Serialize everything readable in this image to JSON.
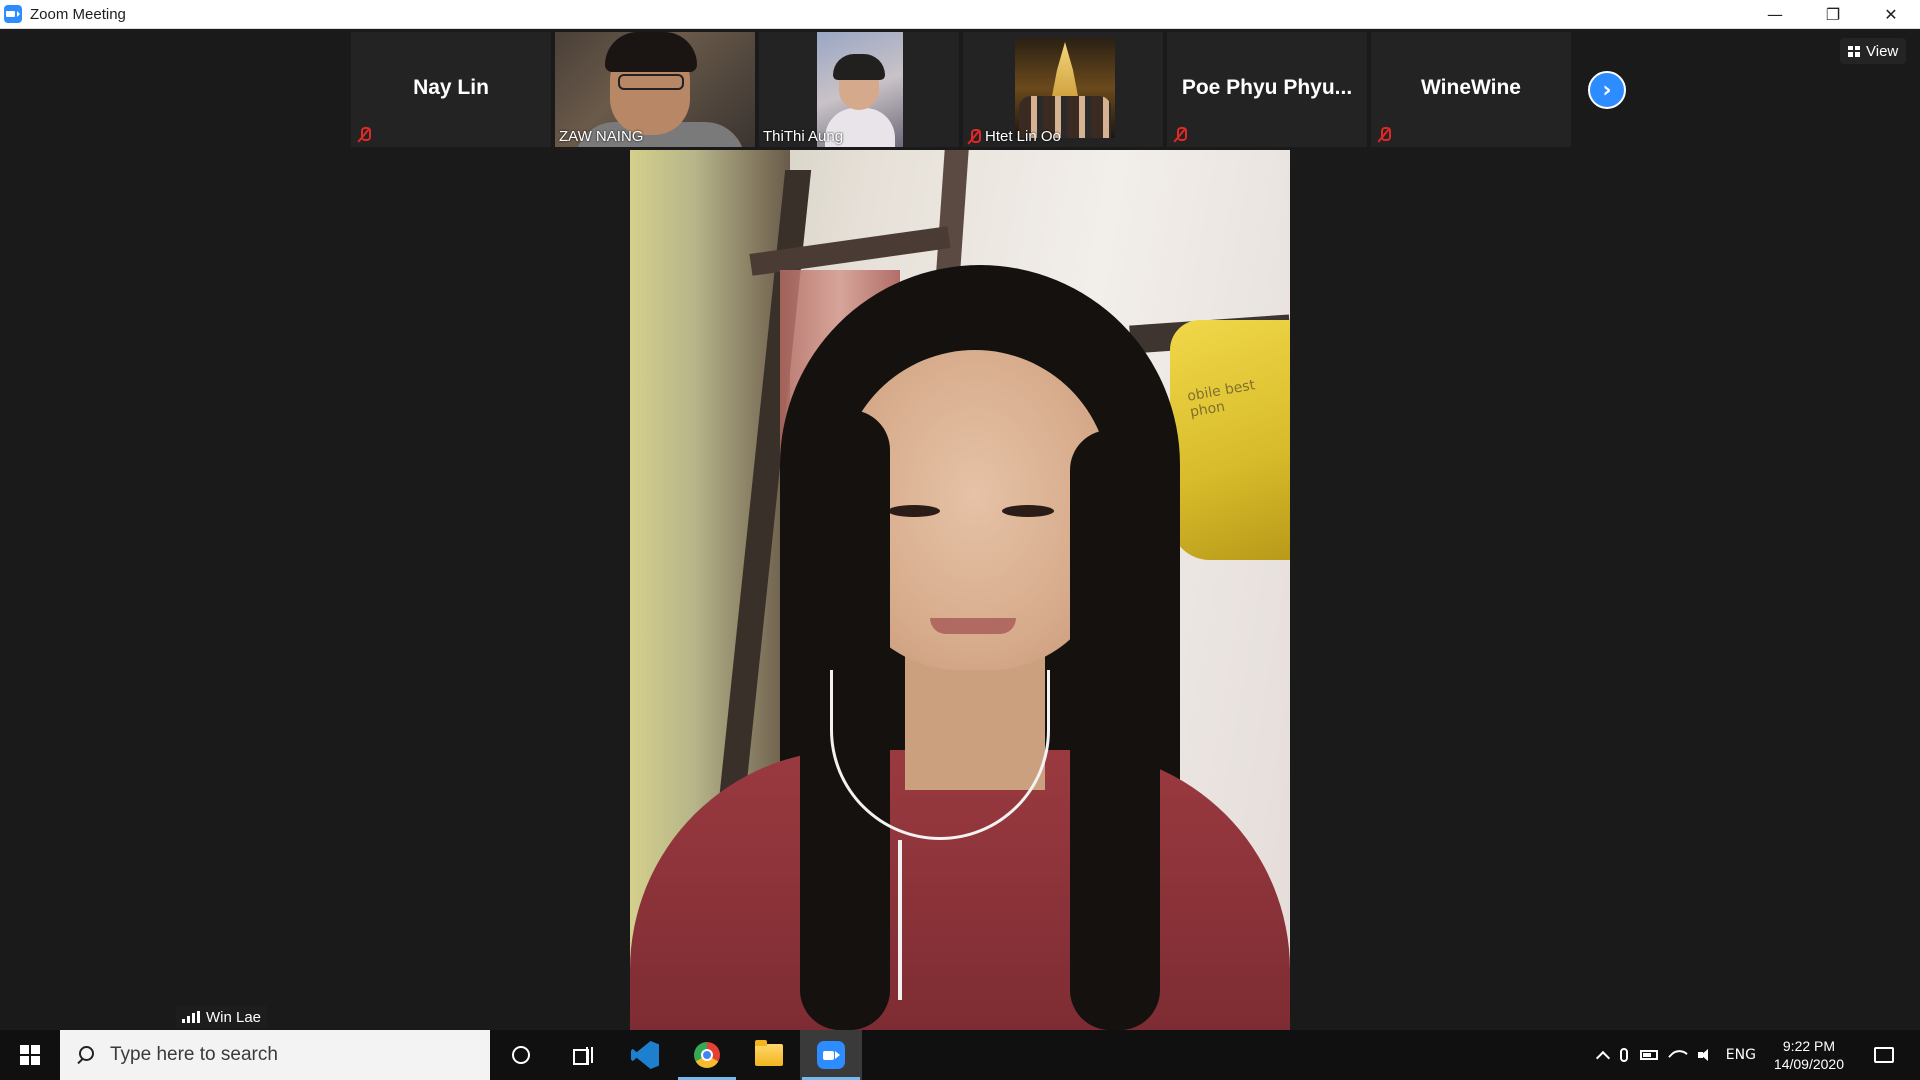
{
  "window": {
    "title": "Zoom Meeting",
    "minimize": "—",
    "restore": "❐",
    "close": "✕"
  },
  "gallery": {
    "tiles": [
      {
        "name": "Nay Lin",
        "show_big_name": true,
        "muted": true
      },
      {
        "name": "ZAW NAING",
        "show_big_name": false,
        "muted": false
      },
      {
        "name": "ThiThi Aung",
        "show_big_name": false,
        "muted": false
      },
      {
        "name": "Htet Lin Oo",
        "show_big_name": false,
        "muted": true
      },
      {
        "name": "Poe Phyu Phyu...",
        "show_big_name": true,
        "muted": true
      },
      {
        "name": "WineWine",
        "show_big_name": true,
        "muted": true
      }
    ],
    "next_icon": "›"
  },
  "view_button": {
    "label": "View"
  },
  "active_speaker": {
    "name": "Win Lae",
    "bag_text": "obile\nbest phon"
  },
  "taskbar": {
    "search_placeholder": "Type here to search",
    "apps": [
      "cortana",
      "task-view",
      "vscode",
      "chrome",
      "file-explorer",
      "zoom"
    ],
    "active_app": "zoom",
    "language": "ENG",
    "time": "9:22 PM",
    "date": "14/09/2020"
  },
  "colors": {
    "zoom_blue": "#2d8cff",
    "muted_red": "#e02828",
    "background": "#1a1a1a",
    "taskbar": "#101010"
  }
}
